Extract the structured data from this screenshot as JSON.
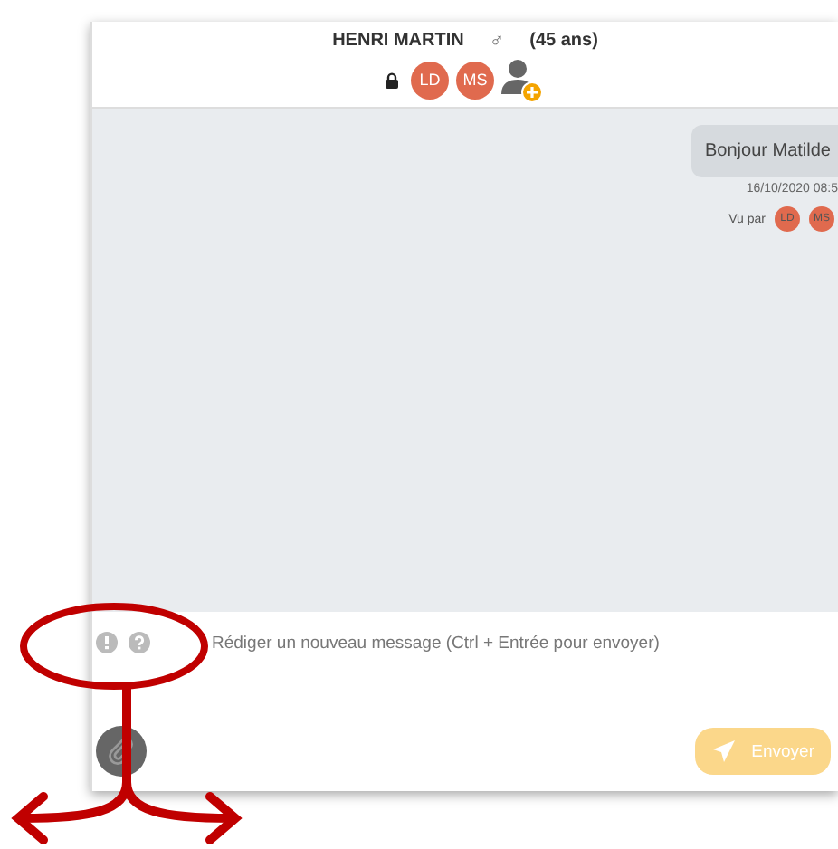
{
  "header": {
    "name": "HENRI MARTIN",
    "gender": "♂",
    "age": "(45 ans)",
    "locked": true,
    "participants": [
      {
        "initials": "LD"
      },
      {
        "initials": "MS"
      }
    ]
  },
  "messages": [
    {
      "text": "Bonjour Matilde",
      "time": "16/10/2020 08:5",
      "seen_label": "Vu par",
      "seen_by": [
        {
          "initials": "LD"
        },
        {
          "initials": "MS"
        }
      ]
    }
  ],
  "composer": {
    "placeholder": "Rédiger un nouveau message (Ctrl + Entrée pour envoyer)",
    "send_label": "Envoyer",
    "send_disabled": true
  }
}
